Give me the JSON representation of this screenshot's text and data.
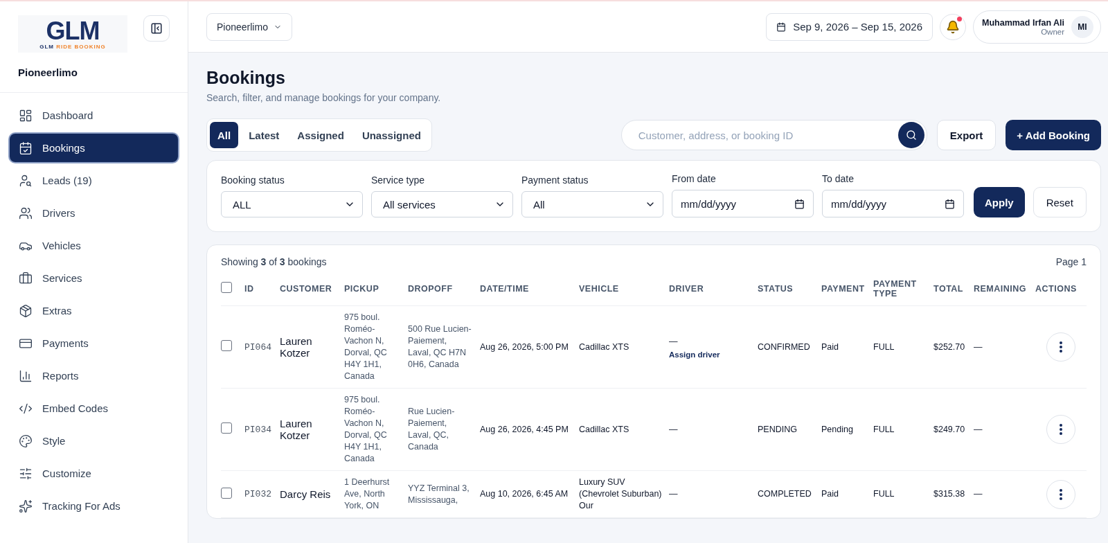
{
  "logo": {
    "title": "GLM",
    "tagline_a": "GLM",
    "tagline_b": "RIDE BOOKING"
  },
  "company": "Pioneerlimo",
  "sidebar": {
    "items": [
      {
        "label": "Dashboard",
        "selected": false
      },
      {
        "label": "Bookings",
        "selected": true
      },
      {
        "label": "Leads (19)",
        "selected": false
      },
      {
        "label": "Drivers",
        "selected": false
      },
      {
        "label": "Vehicles",
        "selected": false
      },
      {
        "label": "Services",
        "selected": false
      },
      {
        "label": "Extras",
        "selected": false
      },
      {
        "label": "Payments",
        "selected": false
      },
      {
        "label": "Reports",
        "selected": false
      },
      {
        "label": "Embed Codes",
        "selected": false
      },
      {
        "label": "Style",
        "selected": false
      },
      {
        "label": "Customize",
        "selected": false
      },
      {
        "label": "Tracking For Ads",
        "selected": false
      }
    ]
  },
  "header": {
    "company_select": "Pioneerlimo",
    "date_range": "Sep 9, 2026 – Sep 15, 2026",
    "notifications_unread": true,
    "user": {
      "name": "Muhammad Irfan Ali",
      "role": "Owner",
      "initials": "MI"
    }
  },
  "page": {
    "title": "Bookings",
    "subtitle": "Search, filter, and manage bookings for your company."
  },
  "tabs": [
    {
      "label": "All",
      "selected": true
    },
    {
      "label": "Latest",
      "selected": false
    },
    {
      "label": "Assigned",
      "selected": false
    },
    {
      "label": "Unassigned",
      "selected": false
    }
  ],
  "search": {
    "placeholder": "Customer, address, or booking ID"
  },
  "actions": {
    "export": "Export",
    "add": "+ Add Booking"
  },
  "filters": [
    {
      "kind": "select",
      "label": "Booking status",
      "value": "ALL"
    },
    {
      "kind": "select",
      "label": "Service type",
      "value": "All services"
    },
    {
      "kind": "select",
      "label": "Payment status",
      "value": "All"
    },
    {
      "kind": "date",
      "label": "From date",
      "placeholder": "mm/dd/yyyy"
    },
    {
      "kind": "date",
      "label": "To date",
      "placeholder": "mm/dd/yyyy"
    }
  ],
  "filter_buttons": {
    "apply": "Apply",
    "reset": "Reset"
  },
  "table": {
    "summary": "Showing **3** of **3** bookings",
    "page": "Page 1",
    "select_all_checked": false,
    "columns": [
      "ID",
      "CUSTOMER",
      "PICKUP",
      "DROPOFF",
      "DATE/TIME",
      "VEHICLE",
      "DRIVER",
      "STATUS",
      "PAYMENT",
      "PAYMENT TYPE",
      "TOTAL",
      "REMAINING",
      "ACTIONS"
    ],
    "rows": [
      {
        "checked": false,
        "id": "PI064",
        "customer": "Lauren Kotzer",
        "pickup": "975 boul. Roméo-Vachon N, Dorval, QC H4Y 1H1, Canada",
        "dropoff": "500 Rue Lucien-Paiement, Laval, QC H7N 0H6, Canada",
        "datetime": "Aug 26, 2026, 5:00 PM",
        "vehicle": "Cadillac XTS",
        "driver": "—",
        "driver_action": "Assign driver",
        "status": "CONFIRMED",
        "payment": "Paid",
        "payment_type": "FULL",
        "total": "$252.70",
        "remaining": "—"
      },
      {
        "checked": false,
        "id": "PI034",
        "customer": "Lauren Kotzer",
        "pickup": "975 boul. Roméo-Vachon N, Dorval, QC H4Y 1H1, Canada",
        "dropoff": "Rue Lucien-Paiement, Laval, QC, Canada",
        "datetime": "Aug 26, 2026, 4:45 PM",
        "vehicle": "Cadillac XTS",
        "driver": "—",
        "status": "PENDING",
        "payment": "Pending",
        "payment_type": "FULL",
        "total": "$249.70",
        "remaining": "—"
      },
      {
        "checked": false,
        "id": "PI032",
        "customer": "Darcy Reis",
        "pickup": "1 Deerhurst Ave, North York, ON",
        "dropoff": "YYZ Terminal 3, Mississauga,",
        "datetime": "Aug 10, 2026, 6:45 AM",
        "vehicle": "Luxury SUV (Chevrolet Suburban) Our",
        "driver": "—",
        "status": "COMPLETED",
        "payment": "Paid",
        "payment_type": "FULL",
        "total": "$315.38",
        "remaining": "—"
      }
    ]
  }
}
